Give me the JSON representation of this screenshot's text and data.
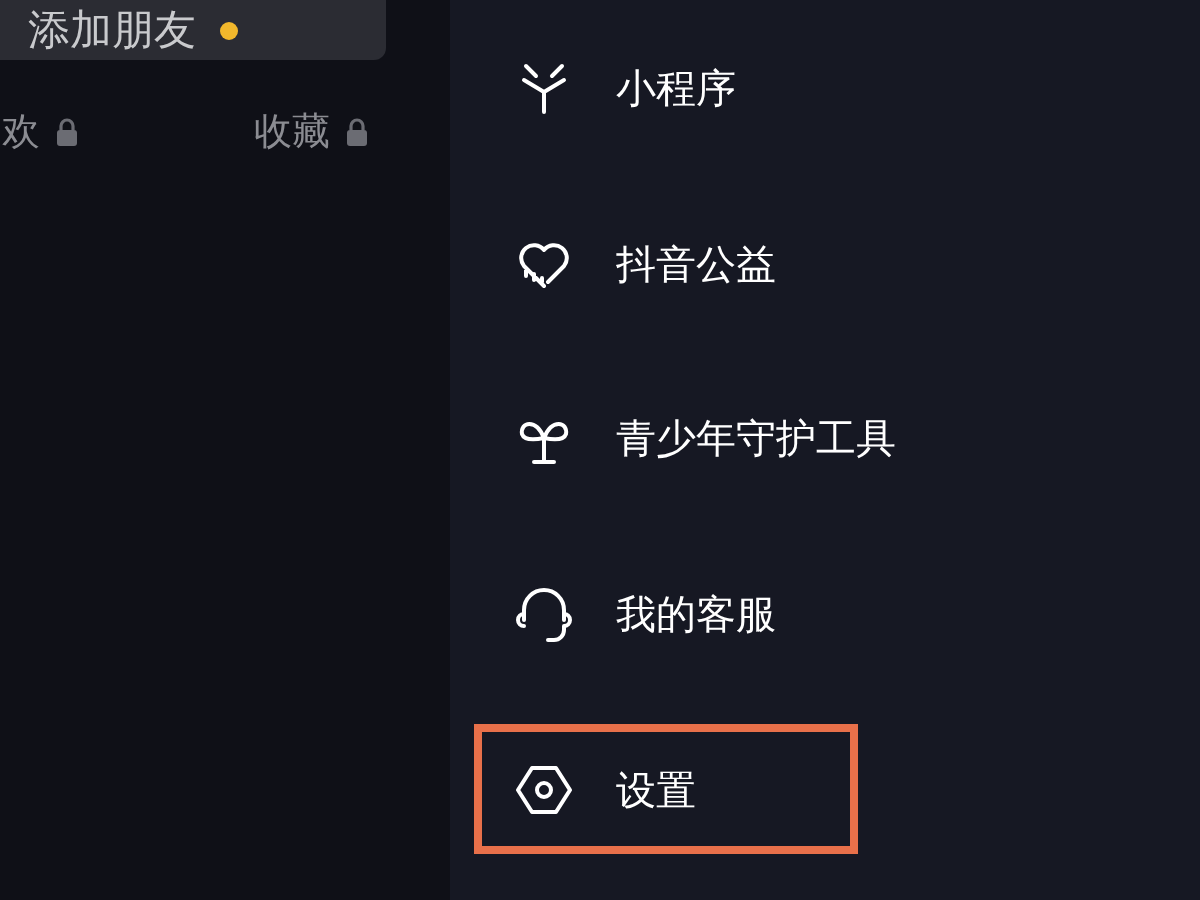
{
  "profile": {
    "add_friend_button": {
      "label": "添加朋友",
      "notification_dot": true
    },
    "tabs": [
      {
        "label": "欢",
        "locked": true
      },
      {
        "label": "收藏",
        "locked": true
      }
    ]
  },
  "menu": [
    {
      "label": "小程序",
      "kind": "sparkle",
      "highlighted": false
    },
    {
      "label": "抖音公益",
      "kind": "heart",
      "highlighted": false
    },
    {
      "label": "青少年守护工具",
      "kind": "sprout",
      "highlighted": false
    },
    {
      "label": "我的客服",
      "kind": "headset",
      "highlighted": false
    },
    {
      "label": "设置",
      "kind": "hexagon",
      "highlighted": true
    }
  ]
}
